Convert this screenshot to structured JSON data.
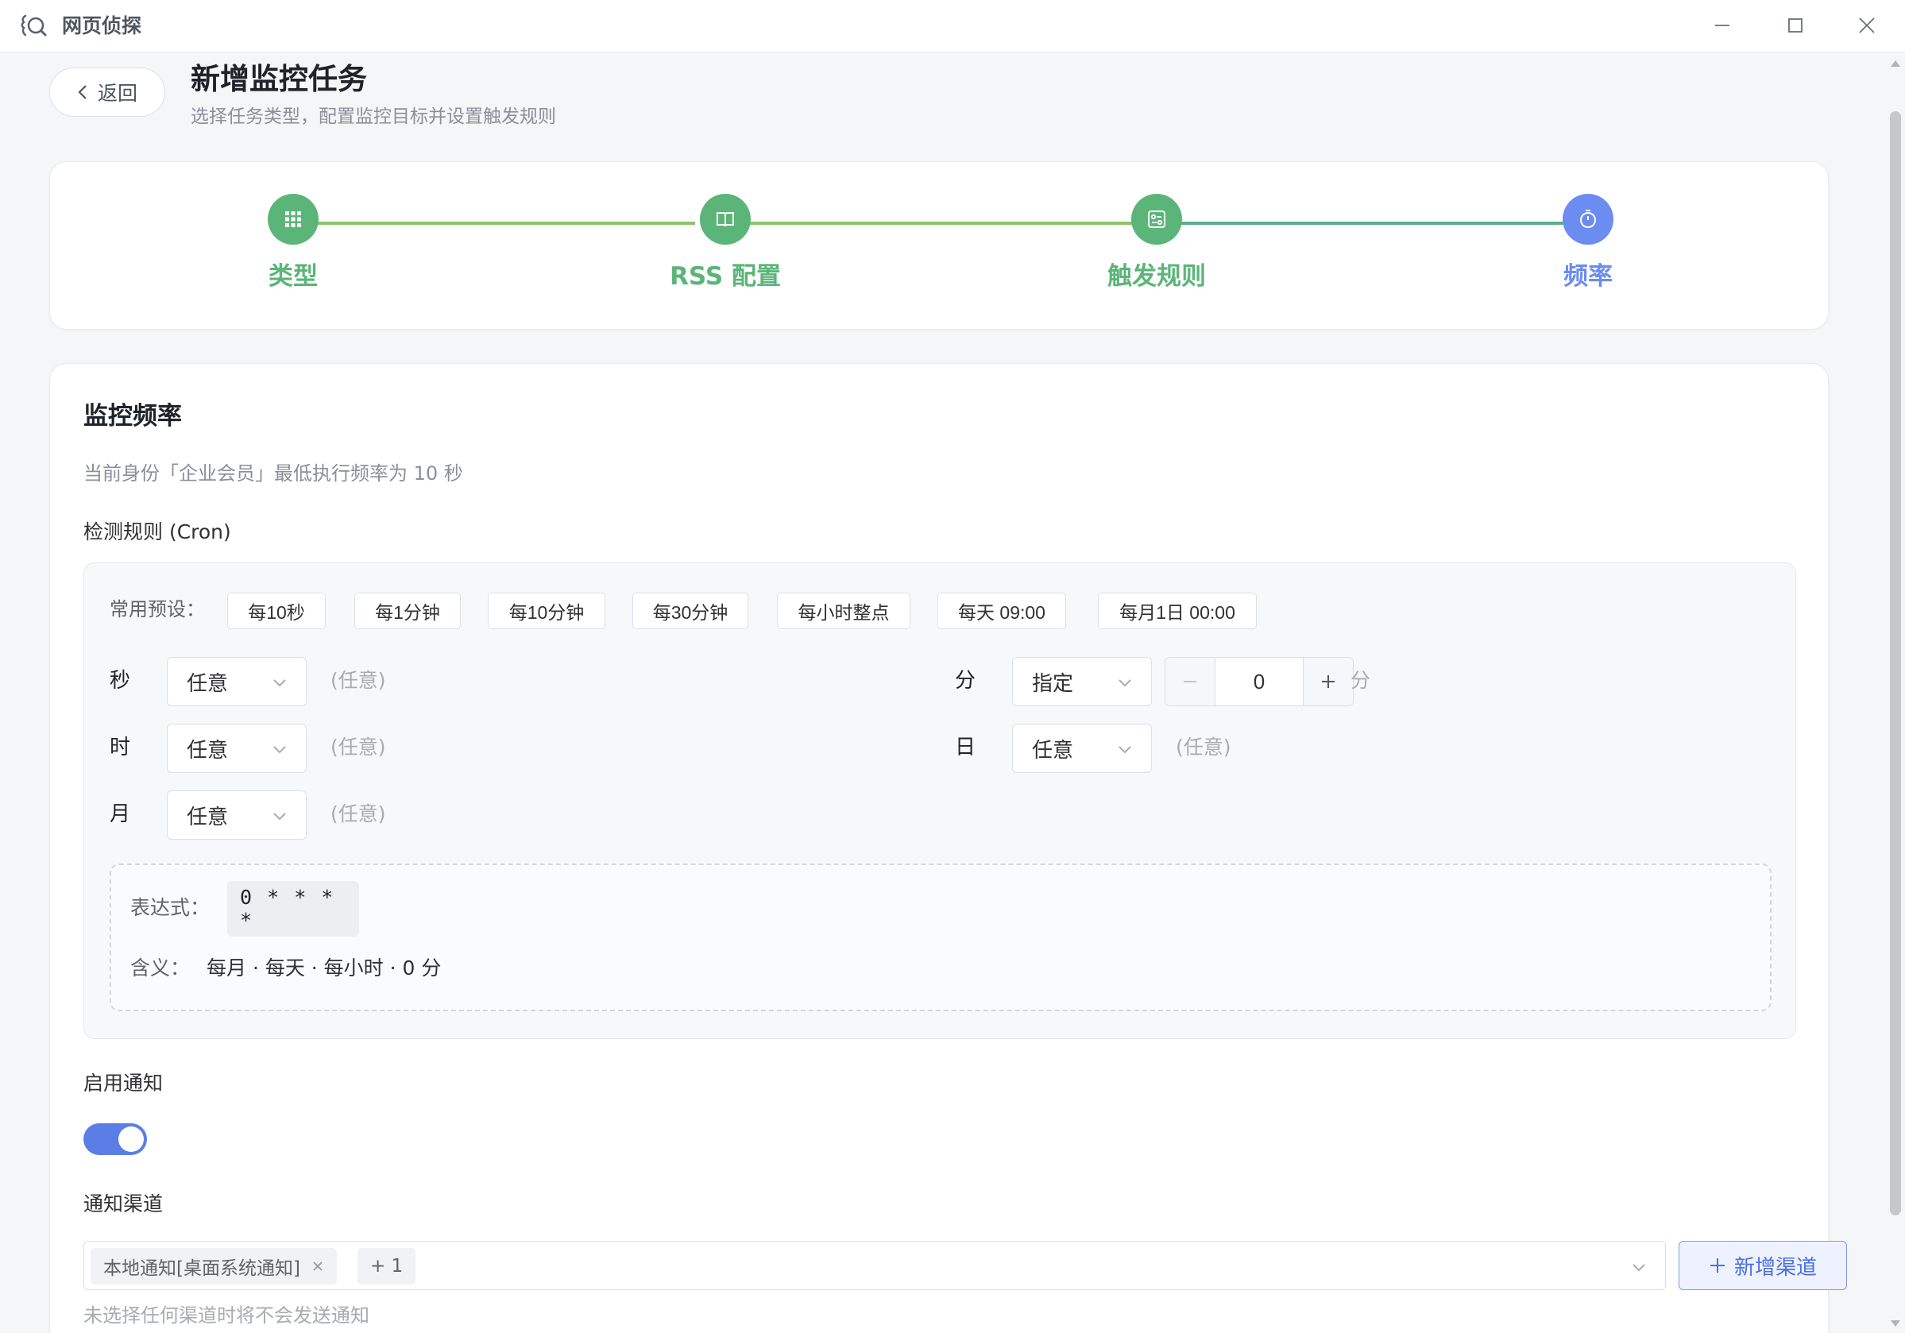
{
  "window": {
    "title": "网页侦探"
  },
  "header": {
    "back_label": "返回",
    "title": "新增监控任务",
    "subtitle": "选择任务类型，配置监控目标并设置触发规则"
  },
  "steps": [
    {
      "label": "类型",
      "icon": "grid-icon",
      "status": "done"
    },
    {
      "label": "RSS 配置",
      "icon": "book-icon",
      "status": "done"
    },
    {
      "label": "触发规则",
      "icon": "rule-icon",
      "status": "done"
    },
    {
      "label": "频率",
      "icon": "timer-icon",
      "status": "active"
    }
  ],
  "colors": {
    "step_done": "#5bb578",
    "step_active": "#6b8cf0",
    "accent": "#5b7ee6"
  },
  "frequency": {
    "section_title": "监控频率",
    "hint": "当前身份「企业会员」最低执行频率为 10 秒",
    "cron_label": "检测规则 (Cron)",
    "preset_label": "常用预设：",
    "presets": [
      "每10秒",
      "每1分钟",
      "每10分钟",
      "每30分钟",
      "每小时整点",
      "每天 09:00",
      "每月1日 00:00"
    ],
    "second": {
      "label": "秒",
      "value": "任意",
      "note": "(任意)"
    },
    "minute": {
      "label": "分",
      "value": "指定",
      "number": "0",
      "unit": "分"
    },
    "hour": {
      "label": "时",
      "value": "任意",
      "note": "(任意)"
    },
    "day": {
      "label": "日",
      "value": "任意",
      "note": "(任意)"
    },
    "month": {
      "label": "月",
      "value": "任意",
      "note": "(任意)"
    },
    "expression_label": "表达式：",
    "expression": "0 * * * *",
    "meaning_label": "含义：",
    "meaning": "每月 · 每天 · 每小时 · 0 分"
  },
  "notification": {
    "enable_label": "启用通知",
    "enabled": true,
    "channel_label": "通知渠道",
    "channels": [
      "本地通知[桌面系统通知]"
    ],
    "more_count": "+ 1",
    "add_channel_label": "新增渠道",
    "hint": "未选择任何渠道时将不会发送通知"
  }
}
